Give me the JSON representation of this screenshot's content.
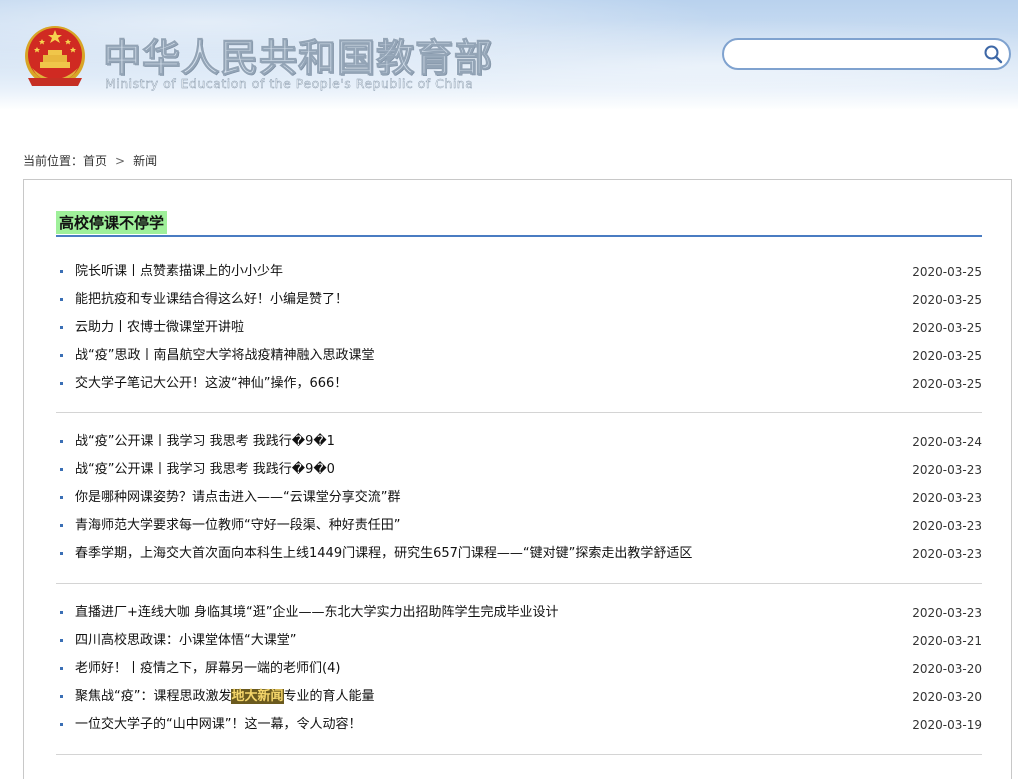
{
  "header": {
    "title": "中华人民共和国教育部",
    "subtitle": "Ministry of Education of the People's Republic of China",
    "search": {
      "value": "",
      "placeholder": ""
    }
  },
  "breadcrumb": {
    "prefix": "当前位置：",
    "home": "首页",
    "separator": ">",
    "current": "新闻"
  },
  "section": {
    "title": "高校停课不停学"
  },
  "groups": [
    [
      {
        "title": "院长听课丨点赞素描课上的小小少年",
        "date": "2020-03-25"
      },
      {
        "title": "能把抗疫和专业课结合得这么好！小编是赞了！",
        "date": "2020-03-25"
      },
      {
        "title": "云助力丨农博士微课堂开讲啦",
        "date": "2020-03-25"
      },
      {
        "title": "战“疫”思政丨南昌航空大学将战疫精神融入思政课堂",
        "date": "2020-03-25"
      },
      {
        "title": "交大学子笔记大公开！这波“神仙”操作，666！",
        "date": "2020-03-25"
      }
    ],
    [
      {
        "title": "战“疫”公开课丨我学习 我思考 我践行�9�1",
        "date": "2020-03-24"
      },
      {
        "title": "战“疫”公开课丨我学习 我思考 我践行�9�0",
        "date": "2020-03-23"
      },
      {
        "title": "你是哪种网课姿势？请点击进入——“云课堂分享交流”群",
        "date": "2020-03-23"
      },
      {
        "title": "青海师范大学要求每一位教师“守好一段渠、种好责任田”",
        "date": "2020-03-23"
      },
      {
        "title": "春季学期，上海交大首次面向本科生上线1449门课程，研究生657门课程——“键对键”探索走出教学舒适区",
        "date": "2020-03-23"
      }
    ],
    [
      {
        "title": "直播进厂+连线大咖 身临其境“逛”企业——东北大学实力出招助阵学生完成毕业设计",
        "date": "2020-03-23"
      },
      {
        "title": "四川高校思政课：小课堂体悟“大课堂”",
        "date": "2020-03-21"
      },
      {
        "title": "老师好！丨疫情之下，屏幕另一端的老师们(4)",
        "date": "2020-03-20"
      },
      {
        "title": "聚焦战“疫”：课程思政激发",
        "title_highlight": "地大新闻",
        "title_after": "专业的育人能量",
        "date": "2020-03-20"
      },
      {
        "title": "一位交大学子的“山中网课”！这一幕，令人动容！",
        "date": "2020-03-19"
      }
    ]
  ],
  "colors": {
    "accent": "#4a7cc2",
    "section_highlight": "#9ff09a",
    "bullet": "#3a6fb5",
    "search_border": "#7fa2cf"
  },
  "icons": {
    "search": "search-icon",
    "emblem": "national-emblem-icon"
  }
}
